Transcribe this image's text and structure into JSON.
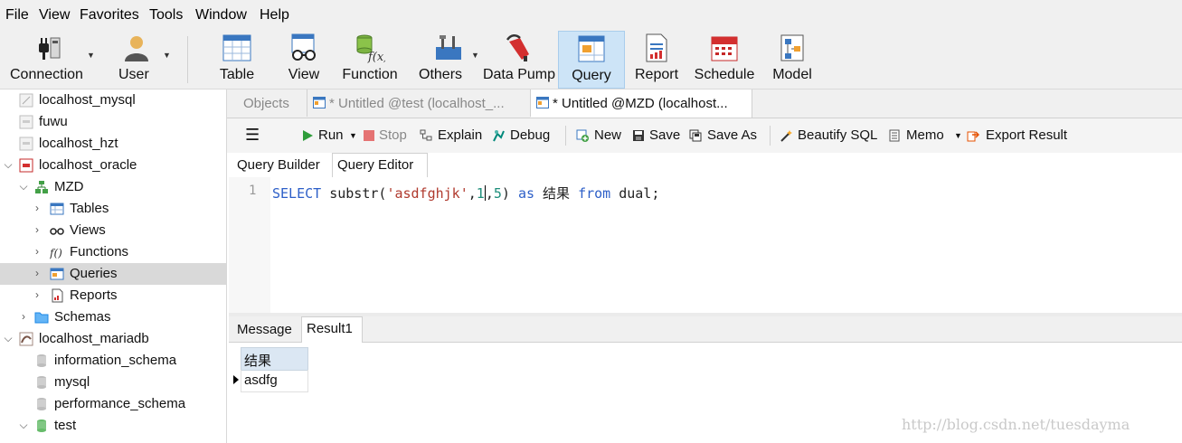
{
  "menu": [
    "File",
    "View",
    "Favorites",
    "Tools",
    "Window",
    "Help"
  ],
  "toolbar": {
    "connection": "Connection",
    "user": "User",
    "table": "Table",
    "view": "View",
    "function": "Function",
    "others": "Others",
    "data_pump": "Data Pump",
    "query": "Query",
    "report": "Report",
    "schedule": "Schedule",
    "model": "Model"
  },
  "sidebar": {
    "items": [
      {
        "label": "localhost_mysql"
      },
      {
        "label": "fuwu"
      },
      {
        "label": "localhost_hzt"
      },
      {
        "label": "localhost_oracle"
      },
      {
        "label": "MZD"
      },
      {
        "label": "Tables"
      },
      {
        "label": "Views"
      },
      {
        "label": "Functions"
      },
      {
        "label": "Queries"
      },
      {
        "label": "Reports"
      },
      {
        "label": "Schemas"
      },
      {
        "label": "localhost_mariadb"
      },
      {
        "label": "information_schema"
      },
      {
        "label": "mysql"
      },
      {
        "label": "performance_schema"
      },
      {
        "label": "test"
      }
    ],
    "selected": "Queries"
  },
  "tabs": {
    "objects": "Objects",
    "untitled_test": "* Untitled @test (localhost_...",
    "untitled_mzd": "* Untitled @MZD (localhost..."
  },
  "editor_toolbar": {
    "run": "Run",
    "stop": "Stop",
    "explain": "Explain",
    "debug": "Debug",
    "new": "New",
    "save": "Save",
    "save_as": "Save As",
    "beautify": "Beautify SQL",
    "memo": "Memo",
    "export": "Export Result"
  },
  "subtabs": {
    "query_builder": "Query Builder",
    "query_editor": "Query Editor"
  },
  "editor": {
    "line_number": "1",
    "tokens": {
      "select": "SELECT",
      "func": " substr(",
      "str": "'asdfghjk'",
      "comma1": ",",
      "num1": "1",
      "comma2": ",",
      "num2": "5",
      "close": ") ",
      "as": "as",
      "alias": " 结果 ",
      "from": "from",
      "table": " dual;"
    }
  },
  "result": {
    "tabs": {
      "message": "Message",
      "result1": "Result1"
    },
    "column": "结果",
    "rows": [
      "asdfg"
    ]
  },
  "watermark": "http://blog.csdn.net/tuesdayma",
  "colors": {
    "keyword": "#2d5fc8",
    "string": "#b03a2e",
    "number": "#1d8d7a",
    "active_tool": "#cde4f7"
  }
}
